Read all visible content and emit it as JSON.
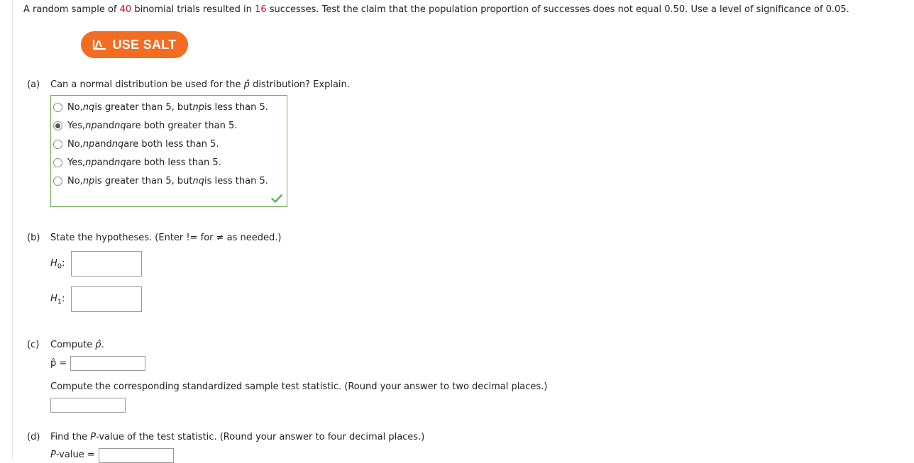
{
  "problem": {
    "p1": "A random sample of ",
    "n": "40",
    "p2": " binomial trials resulted in ",
    "x": "16",
    "p3": " successes. Test the claim that the population proportion of successes does not equal 0.50. Use a level of significance of 0.05."
  },
  "salt": {
    "label": "USE SALT",
    "color": "#f26c22",
    "icon": "salt-logo-icon"
  },
  "part_a": {
    "label": "(a)",
    "q1": "Can a normal distribution be used for the ",
    "q_symbol": "p̂",
    "q2": " distribution? Explain.",
    "options": [
      {
        "parts": [
          "No, ",
          "nq",
          " is greater than 5, but ",
          "np",
          " is less than 5."
        ],
        "selected": false
      },
      {
        "parts": [
          "Yes, ",
          "np",
          " and ",
          "nq",
          " are both greater than 5."
        ],
        "selected": true
      },
      {
        "parts": [
          "No, ",
          "np",
          " and ",
          "nq",
          " are both less than 5."
        ],
        "selected": false
      },
      {
        "parts": [
          "Yes, ",
          "np",
          " and ",
          "nq",
          " are both less than 5."
        ],
        "selected": false
      },
      {
        "parts": [
          "No, ",
          "np",
          " is greater than 5, but ",
          "nq",
          " is less than 5."
        ],
        "selected": false
      }
    ],
    "status": "correct",
    "status_color": "#5cb85c",
    "border_color": "#6bb04f"
  },
  "part_b": {
    "label": "(b)",
    "text": "State the hypotheses. (Enter != for ≠ as needed.)",
    "h0": {
      "letter": "H",
      "sub": "0",
      "colon": ":",
      "value": ""
    },
    "h1": {
      "letter": "H",
      "sub": "1",
      "colon": ":",
      "value": ""
    }
  },
  "part_c": {
    "label": "(c)",
    "text1": "Compute ",
    "symbol": "p̂",
    "text2": ".",
    "phat_label": "p̂ =",
    "phat_value": "",
    "text3": "Compute the corresponding standardized sample test statistic. (Round your answer to two decimal places.)",
    "z_value": ""
  },
  "part_d": {
    "label": "(d)",
    "text1": "Find the ",
    "italic": "P",
    "text2": "-value of the test statistic. (Round your answer to four decimal places.)",
    "pval_italic": "P",
    "pval_rest": "-value =",
    "pval_value": ""
  }
}
